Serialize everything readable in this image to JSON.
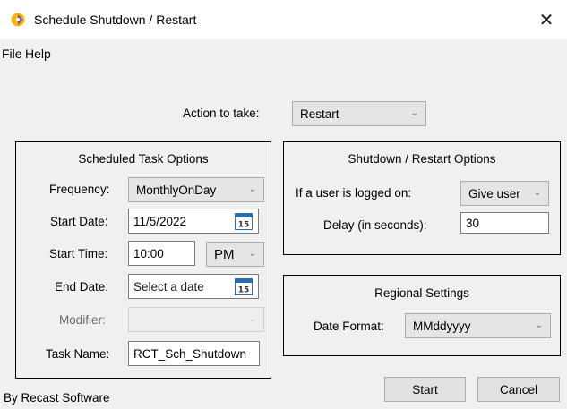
{
  "window": {
    "title": "Schedule Shutdown / Restart",
    "close_glyph": "✕"
  },
  "menu": {
    "file": "File",
    "help": "Help"
  },
  "action": {
    "label": "Action to take:",
    "value": "Restart"
  },
  "scheduled": {
    "title": "Scheduled Task Options",
    "frequency_label": "Frequency:",
    "frequency_value": "MonthlyOnDay",
    "start_date_label": "Start Date:",
    "start_date_value": "11/5/2022",
    "start_time_label": "Start Time:",
    "start_time_value": "10:00",
    "ampm_value": "PM",
    "end_date_label": "End Date:",
    "end_date_placeholder": "Select a date",
    "modifier_label": "Modifier:",
    "modifier_value": "",
    "task_name_label": "Task Name:",
    "task_name_value": "RCT_Sch_Shutdown",
    "calendar_day": "15"
  },
  "shutdown": {
    "title": "Shutdown / Restart Options",
    "logged_on_label": "If a user is logged on:",
    "logged_on_value": "Give user",
    "delay_label": "Delay (in seconds):",
    "delay_value": "30"
  },
  "regional": {
    "title": "Regional Settings",
    "date_format_label": "Date Format:",
    "date_format_value": "MMddyyyy"
  },
  "buttons": {
    "start": "Start",
    "cancel": "Cancel"
  },
  "footer": {
    "credit": "By Recast Software"
  },
  "icons": {
    "app": "app-logo-icon",
    "dropdown": "chevron-down-icon",
    "calendar": "calendar-icon",
    "close": "close-icon"
  },
  "colors": {
    "app_icon_primary": "#f5b800",
    "app_icon_secondary": "#7b3fc4",
    "calendar_blue": "#2b6cb0"
  }
}
